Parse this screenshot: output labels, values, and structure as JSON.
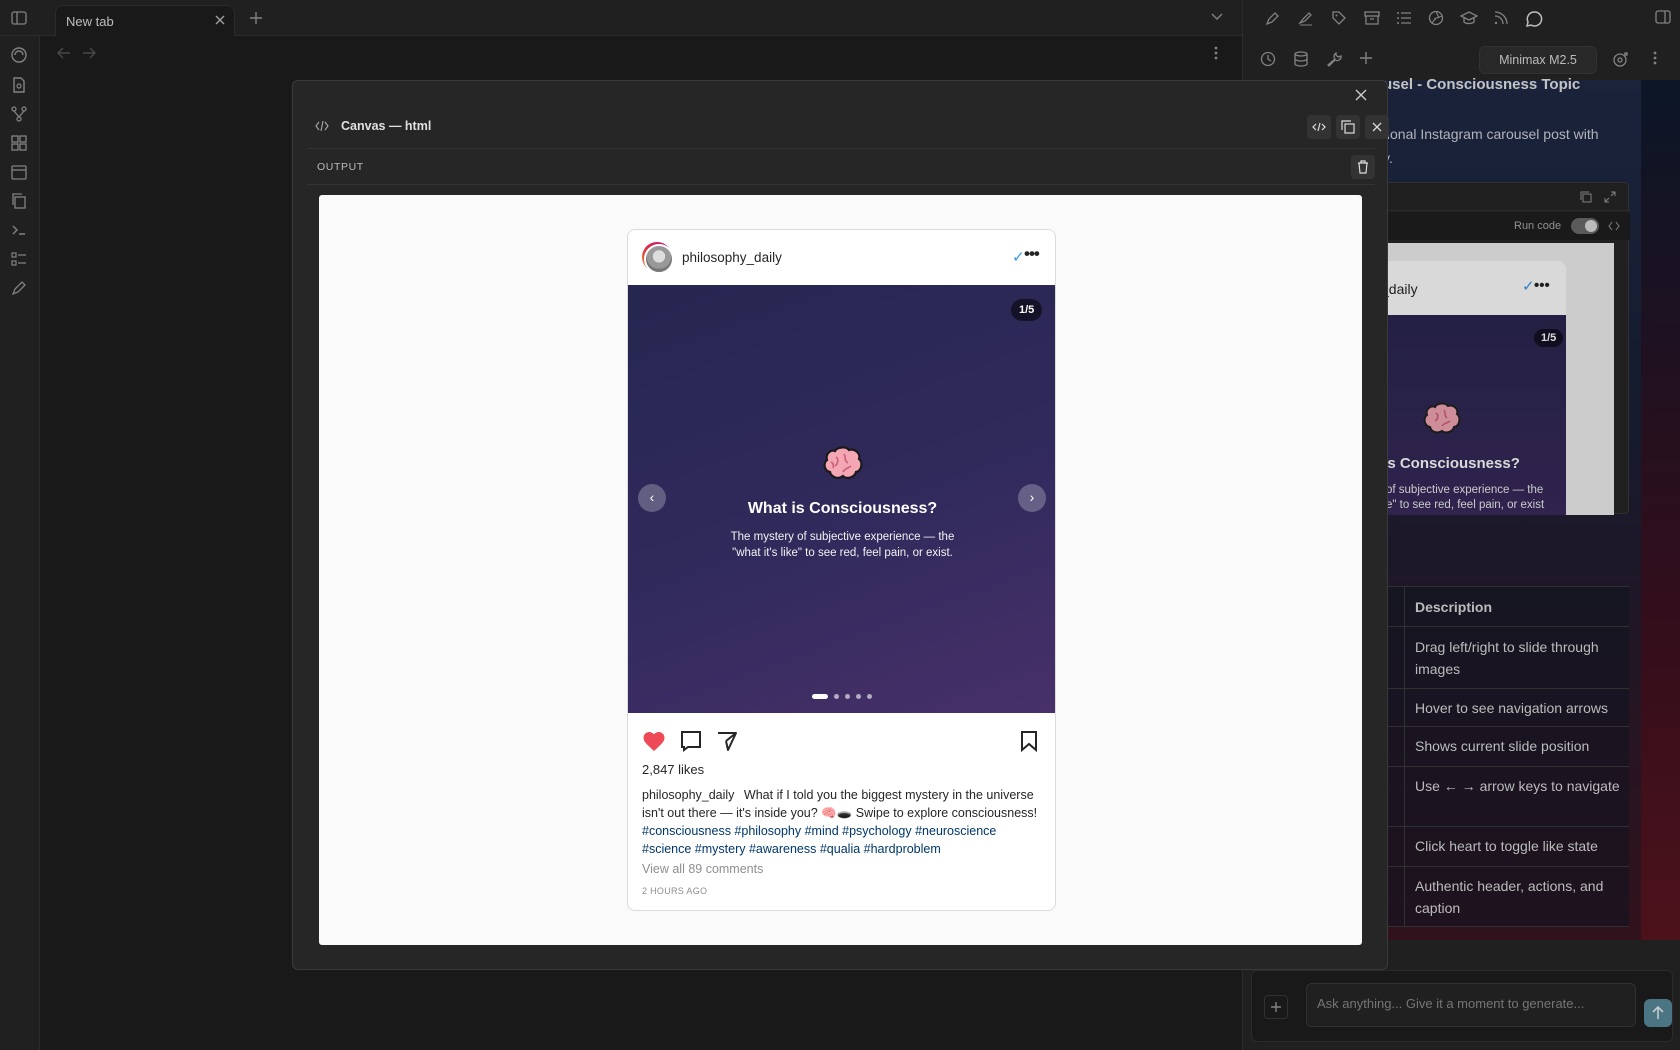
{
  "tabs": {
    "active_label": "New tab"
  },
  "right_panel": {
    "model": "Minimax M2.5",
    "heading": "usel - Consciousness Topic",
    "para_line1": "tional Instagram carousel post with",
    "para_line2": "y.",
    "run_code": "Run code",
    "preview_username": "y_daily",
    "preview_counter": "1/5",
    "preview_title": "t is Consciousness?",
    "preview_sub_1": "of subjective experience — the",
    "preview_sub_2": "e\" to see red, feel pain, or exist",
    "features_colon": ":",
    "table": {
      "header": "Description",
      "rows": [
        "Drag left/right to slide through images",
        "Hover to see navigation arrows",
        "Shows current slide position",
        "Use ← → arrow keys to navigate",
        "Click heart to toggle like state",
        "Authentic header, actions, and caption"
      ]
    },
    "composer_placeholder": "Ask anything... Give it a moment to generate..."
  },
  "canvas": {
    "title": "Canvas — html",
    "output_label": "OUTPUT"
  },
  "post": {
    "username": "philosophy_daily",
    "verified_mark": "✓",
    "more": "•••",
    "counter": "1/5",
    "emoji": "brain-emoji",
    "title": "What is Consciousness?",
    "subtitle_line1": "The mystery of subjective experience — the",
    "subtitle_line2": "\"what it's like\" to see red, feel pain, or exist.",
    "prev": "‹",
    "next": "›",
    "slide_count": 5,
    "active_slide": 1,
    "likes": "2,847 likes",
    "caption_user": "philosophy_daily",
    "caption_text": "What if I told you the biggest mystery in the universe isn't out there — it's inside you? 🧠🕳️ Swipe to explore consciousness!",
    "hashtags": "#consciousness #philosophy #mind #psychology #neuroscience #science #mystery #awareness #qualia #hardproblem",
    "comments": "View all 89 comments",
    "time_ago": "2 HOURS AGO",
    "like_color": "#ed4956"
  }
}
